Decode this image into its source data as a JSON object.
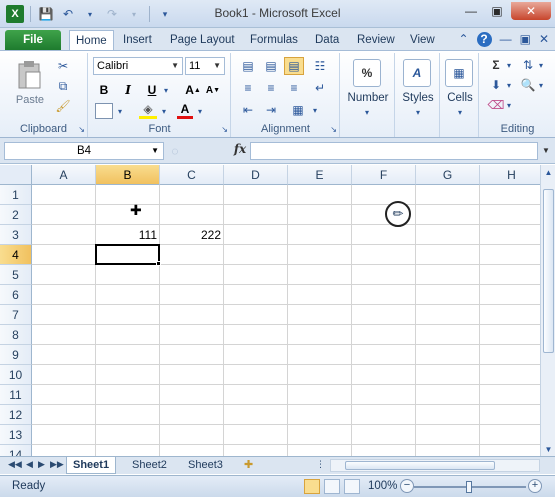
{
  "window": {
    "title": "Book1  -  Microsoft Excel"
  },
  "qat": {
    "save_icon": "save-icon",
    "undo_icon": "undo-icon",
    "redo_icon": "redo-icon"
  },
  "tabs": [
    {
      "label": "File"
    },
    {
      "label": "Home"
    },
    {
      "label": "Insert"
    },
    {
      "label": "Page Layout"
    },
    {
      "label": "Formulas"
    },
    {
      "label": "Data"
    },
    {
      "label": "Review"
    },
    {
      "label": "View"
    }
  ],
  "ribbon": {
    "clipboard": {
      "label": "Clipboard",
      "paste_label": "Paste"
    },
    "font": {
      "label": "Font",
      "font_name": "Calibri",
      "font_size": "11"
    },
    "alignment": {
      "label": "Alignment"
    },
    "number": {
      "label": "Number"
    },
    "styles": {
      "label": "Styles"
    },
    "cells": {
      "label": "Cells"
    },
    "editing": {
      "label": "Editing"
    }
  },
  "formula_bar": {
    "name_box": "B4",
    "fx": "fx",
    "value": ""
  },
  "columns": [
    "A",
    "B",
    "C",
    "D",
    "E",
    "F",
    "G",
    "H"
  ],
  "rows": [
    "1",
    "2",
    "3",
    "4",
    "5",
    "6",
    "7",
    "8",
    "9",
    "10",
    "11",
    "12",
    "13",
    "14"
  ],
  "cells": {
    "B3": "111",
    "C3": "222"
  },
  "selected": {
    "cell": "B4",
    "column": "B",
    "row": "4"
  },
  "sheets": [
    {
      "label": "Sheet1",
      "active": true
    },
    {
      "label": "Sheet2",
      "active": false
    },
    {
      "label": "Sheet3",
      "active": false
    }
  ],
  "status": {
    "ready": "Ready",
    "zoom": "100%"
  }
}
